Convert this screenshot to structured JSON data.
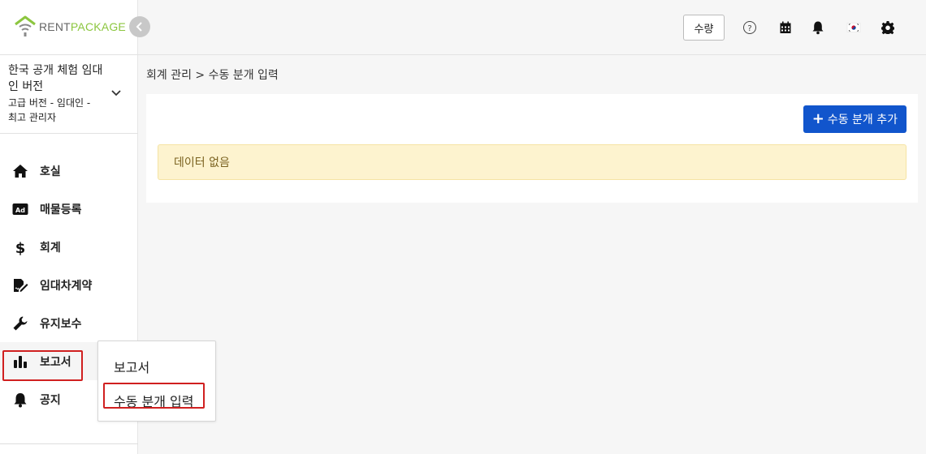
{
  "logo": {
    "text_rent": "RENT",
    "text_package": "PACKAGE",
    "brand_color": "#8cc63f"
  },
  "account": {
    "name": "한국 공개 체험 임대인 버전",
    "role": "고급 버전 - 임대인 - 최고 관리자"
  },
  "nav": {
    "items": [
      {
        "label": "호실",
        "icon": "home-icon"
      },
      {
        "label": "매물등록",
        "icon": "ad-icon"
      },
      {
        "label": "회계",
        "icon": "dollar-icon"
      },
      {
        "label": "임대차계약",
        "icon": "contract-sign-icon"
      },
      {
        "label": "유지보수",
        "icon": "wrench-icon"
      },
      {
        "label": "보고서",
        "icon": "bar-chart-icon",
        "active": true
      },
      {
        "label": "공지",
        "icon": "bell-icon"
      }
    ]
  },
  "topbar": {
    "quantity_label": "수량",
    "icons": [
      "help-icon",
      "calendar-icon",
      "notification-bell-icon",
      "korea-flag-icon",
      "settings-gear-icon"
    ]
  },
  "breadcrumb": "회계 관리 > 수동 분개 입력",
  "main": {
    "add_button_label": "수동 분개 추가",
    "empty_message": "데이터 없음"
  },
  "submenu": {
    "items": [
      "보고서",
      "수동 분개 입력"
    ]
  },
  "colors": {
    "accent_blue": "#1155cc",
    "highlight_red": "#d02020",
    "alert_bg": "#fdf3cf"
  }
}
